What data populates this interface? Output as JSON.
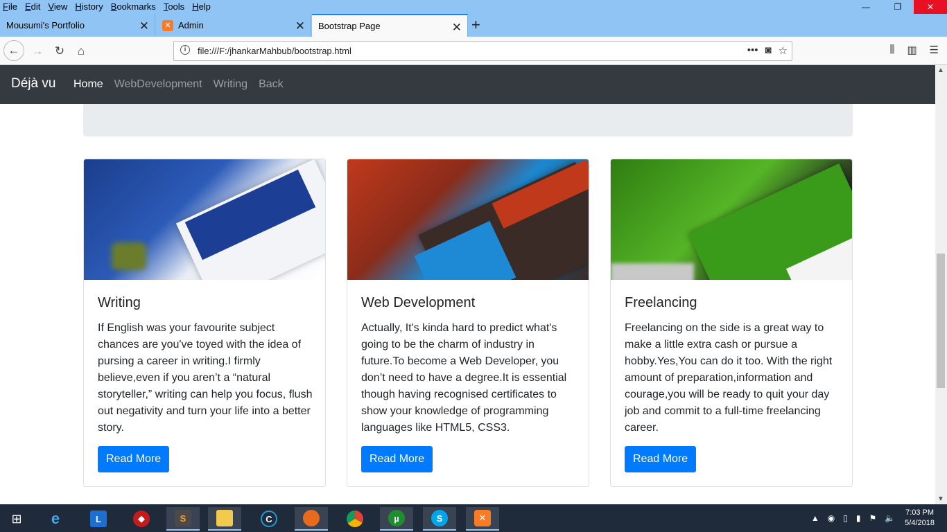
{
  "browser": {
    "menu": [
      "File",
      "Edit",
      "View",
      "History",
      "Bookmarks",
      "Tools",
      "Help"
    ],
    "tabs": [
      {
        "label": "Mousumi's Portfolio"
      },
      {
        "label": "Admin"
      },
      {
        "label": "Bootstrap Page"
      }
    ],
    "url": "file:///F:/jhankarMahbub/bootstrap.html",
    "icons": {
      "back": "arrow-left-icon",
      "forward": "arrow-right-icon",
      "reload": "reload-icon",
      "home": "home-icon"
    }
  },
  "site": {
    "brand": "Déjà vu",
    "nav": [
      {
        "label": "Home",
        "active": true
      },
      {
        "label": "WebDevelopment",
        "active": false
      },
      {
        "label": "Writing",
        "active": false
      },
      {
        "label": "Back",
        "active": false
      }
    ],
    "cards": [
      {
        "title": "Writing",
        "text": "If English was your favourite subject chances are you've toyed with the idea of pursing a career in writing.I firmly believe,even if you aren’t a “natural storyteller,” writing can help you focus, flush out negativity and turn your life into a better story.",
        "button": "Read More"
      },
      {
        "title": "Web Development",
        "text": "Actually, It's kinda hard to predict what's going to be the charm of industry in future.To become a Web Developer, you don’t need to have a degree.It is essential though having recognised certificates to show your knowledge of programming languages like HTML5, CSS3.",
        "button": "Read More"
      },
      {
        "title": "Freelancing",
        "text": "Freelancing on the side is a great way to make a little extra cash or pursue a hobby.Yes,You can do it too. With the right amount of preparation,information and courage,you will be ready to quit your day job and commit to a full-time freelancing career.",
        "button": "Read More"
      }
    ]
  },
  "taskbar": {
    "time": "7:03 PM",
    "date": "5/4/2018"
  },
  "colors": {
    "navbar": "#343a40",
    "primary": "#007bff",
    "jumbotron": "#e9ecef"
  }
}
